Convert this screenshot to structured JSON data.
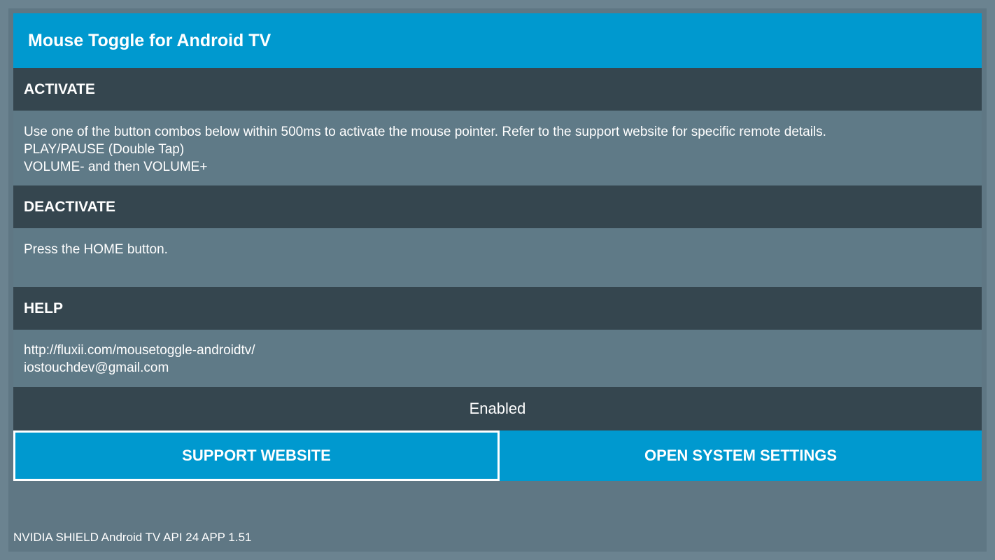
{
  "app": {
    "title": "Mouse Toggle for Android TV"
  },
  "activate": {
    "heading": "ACTIVATE",
    "lines": [
      "Use one of the button combos below within 500ms to activate the mouse pointer. Refer to the support website for specific remote details.",
      "PLAY/PAUSE (Double Tap)",
      "VOLUME- and then VOLUME+"
    ]
  },
  "deactivate": {
    "heading": "DEACTIVATE",
    "lines": [
      "Press the HOME button."
    ]
  },
  "help": {
    "heading": "HELP",
    "lines": [
      "http://fluxii.com/mousetoggle-androidtv/",
      "iostouchdev@gmail.com"
    ]
  },
  "status": {
    "text": "Enabled"
  },
  "buttons": {
    "support_label": "SUPPORT WEBSITE",
    "settings_label": "OPEN SYSTEM SETTINGS"
  },
  "footer": {
    "text": "NVIDIA SHIELD Android TV API 24 APP 1.51"
  },
  "colors": {
    "accent": "#0099cf",
    "header_dark": "#35464f",
    "body_bg": "#5f7a87"
  }
}
